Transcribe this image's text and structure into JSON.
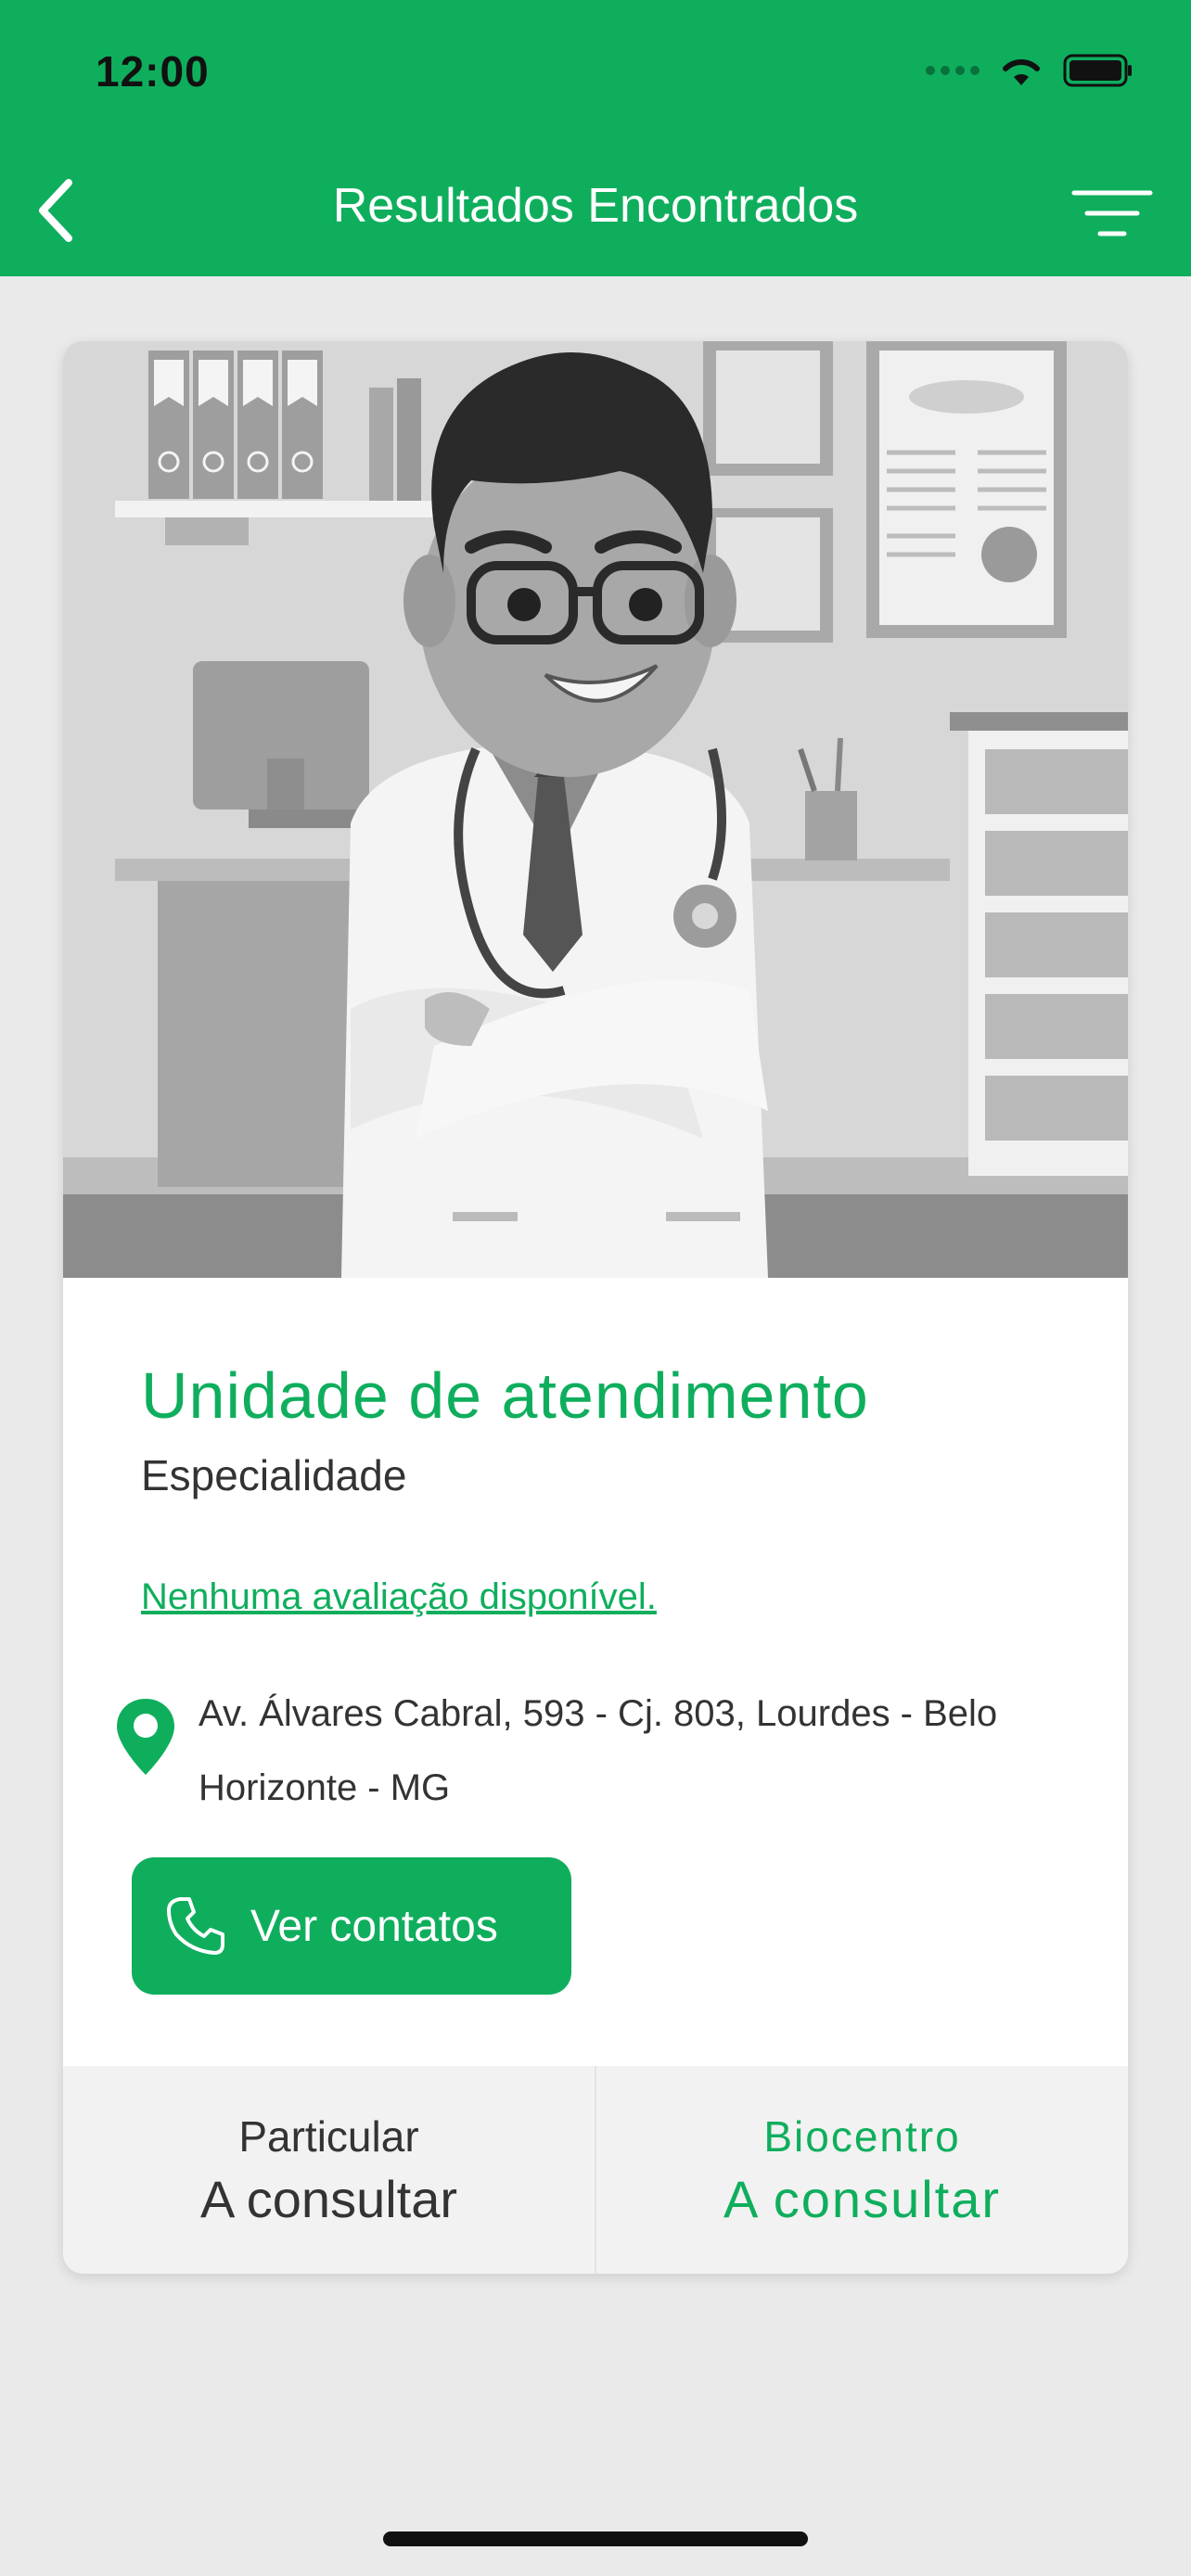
{
  "status_bar": {
    "time": "12:00"
  },
  "nav": {
    "title": "Resultados Encontrados"
  },
  "card": {
    "unit_name": "Unidade de atendimento",
    "specialty": "Especialidade",
    "reviews_link": "Nenhuma avaliação disponível.",
    "address": "Av. Álvares Cabral, 593 - Cj. 803, Lourdes - Belo Horizonte - MG",
    "contacts_button": "Ver contatos",
    "prices": [
      {
        "label": "Particular",
        "value": "A consultar"
      },
      {
        "label": "Biocentro",
        "value": "A consultar"
      }
    ]
  },
  "colors": {
    "brand_green": "#0fae5d",
    "background": "#eaeaea"
  },
  "icons": [
    "back-arrow-icon",
    "filter-icon",
    "location-pin-icon",
    "phone-icon",
    "wifi-icon",
    "battery-icon",
    "signal-icon"
  ]
}
